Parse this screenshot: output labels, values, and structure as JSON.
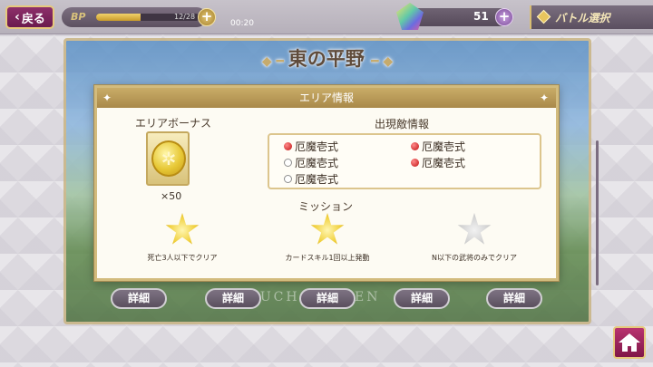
{
  "topbar": {
    "back_label": "戻る",
    "bp_label": "BP",
    "bp_count": "12/28",
    "bp_fraction": 0.43,
    "bp_time": "00:20",
    "gem_count": "51",
    "battle_select": "バトル選択"
  },
  "map": {
    "title": "東の平野",
    "touch_text": "TOUCH SCREEN",
    "detail_buttons": [
      "詳細",
      "詳細",
      "詳細",
      "詳細",
      "詳細"
    ]
  },
  "modal": {
    "header": "エリア情報",
    "bonus_title": "エリアボーナス",
    "bonus_count": "×50",
    "enemy_title": "出現敵情報",
    "enemies": [
      {
        "name": "厄魔壱式",
        "status": "red"
      },
      {
        "name": "厄魔壱式",
        "status": "red"
      },
      {
        "name": "厄魔壱式",
        "status": "empty"
      },
      {
        "name": "厄魔壱式",
        "status": "red"
      },
      {
        "name": "厄魔壱式",
        "status": "empty"
      }
    ],
    "mission_title": "ミッション",
    "missions": [
      {
        "label": "死亡3人以下でクリア",
        "achieved": true
      },
      {
        "label": "カードスキル1回以上発動",
        "achieved": true
      },
      {
        "label": "N以下の武将のみでクリア",
        "achieved": false
      }
    ]
  },
  "colors": {
    "accent_gold": "#c9ac67",
    "back_button": "#8e2f6a",
    "home_button": "#b8336f"
  }
}
